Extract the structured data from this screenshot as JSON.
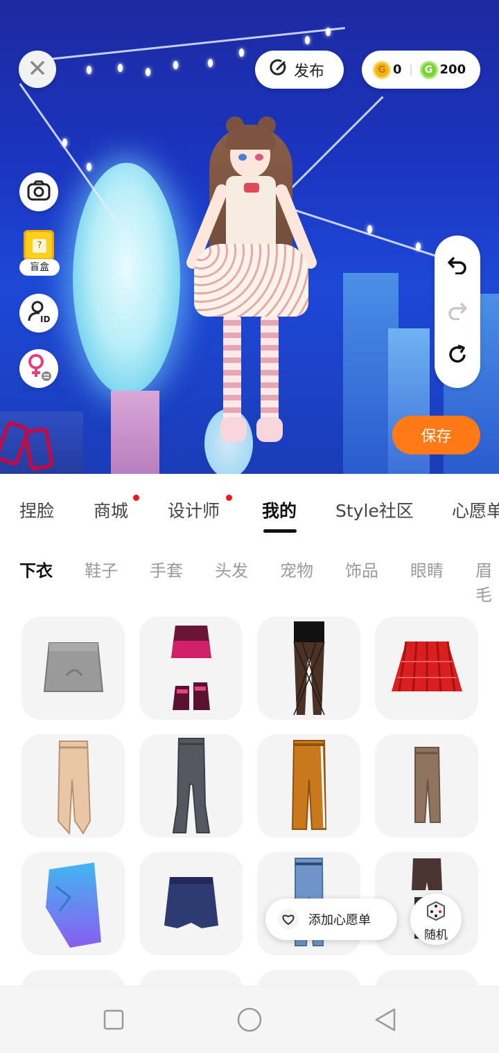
{
  "top_bar": {
    "publish_label": "发布",
    "gold_coins": "0",
    "green_coins": "200"
  },
  "side_tools": {
    "blind_box_label": "盲盒",
    "blind_box_mark": "?"
  },
  "save_label": "保存",
  "tabs": [
    {
      "label": "捏脸",
      "active": false,
      "dot": false
    },
    {
      "label": "商城",
      "active": false,
      "dot": true
    },
    {
      "label": "设计师",
      "active": false,
      "dot": true
    },
    {
      "label": "我的",
      "active": true,
      "dot": false
    },
    {
      "label": "Style社区",
      "active": false,
      "dot": false
    },
    {
      "label": "心愿单",
      "active": false,
      "dot": false
    }
  ],
  "subtabs": [
    {
      "label": "下衣",
      "active": true
    },
    {
      "label": "鞋子",
      "active": false
    },
    {
      "label": "手套",
      "active": false
    },
    {
      "label": "头发",
      "active": false
    },
    {
      "label": "宠物",
      "active": false
    },
    {
      "label": "饰品",
      "active": false
    },
    {
      "label": "眼睛",
      "active": false
    },
    {
      "label": "眉毛",
      "active": false
    }
  ],
  "items": [
    {
      "icon": "gray-mini-skirt-icon",
      "color": "#9a9a9a"
    },
    {
      "icon": "pink-skirt-boots-icon",
      "color": "#c2185b"
    },
    {
      "icon": "fishnet-leggings-icon",
      "color": "#3a2a22"
    },
    {
      "icon": "red-plaid-skirt-icon",
      "color": "#d91f1f"
    },
    {
      "icon": "beige-lace-pants-icon",
      "color": "#e8c6a6"
    },
    {
      "icon": "gray-flare-jeans-icon",
      "color": "#555861"
    },
    {
      "icon": "orange-track-pants-icon",
      "color": "#c9791b"
    },
    {
      "icon": "brown-pants-icon",
      "color": "#8f7560"
    },
    {
      "icon": "blue-wrap-skirt-icon",
      "color": "#5aa6e8"
    },
    {
      "icon": "navy-skirt-icon",
      "color": "#2e3b73"
    },
    {
      "icon": "light-jeans-icon",
      "color": "#6f94c7"
    },
    {
      "icon": "dark-shorts-icon",
      "color": "#4a3434"
    }
  ],
  "wishlist_label": "添加心愿单",
  "random_label": "随机",
  "colors": {
    "accent_orange": "#ff7a14",
    "badge_red": "#f01818",
    "gold": "#f2b21c",
    "green": "#7bd33c"
  }
}
